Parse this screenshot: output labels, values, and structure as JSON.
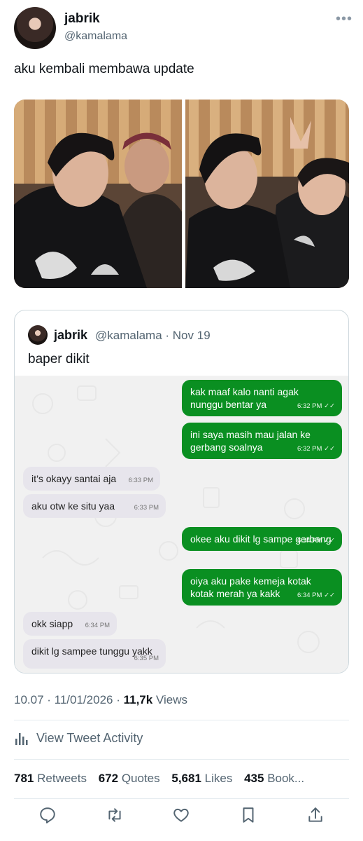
{
  "user": {
    "name": "jabrik",
    "handle": "@kamalama",
    "more_icon": "more-icon"
  },
  "tweet": {
    "text": "aku kembali membawa update"
  },
  "quote": {
    "name": "jabrik",
    "meta": "@kamalama · Nov 19",
    "text": "baper dikit",
    "messages": [
      {
        "dir": "out",
        "text": "kak maaf kalo nanti agak nunggu bentar ya",
        "time": "6:32 PM"
      },
      {
        "dir": "out",
        "text": "ini saya masih mau jalan ke gerbang soalnya",
        "time": "6:32 PM"
      },
      {
        "dir": "in",
        "text": "it’s okayy santai aja",
        "time": "6:33 PM"
      },
      {
        "dir": "in",
        "text": "aku otw ke situ yaa",
        "time": "6:33 PM"
      },
      {
        "dir": "out",
        "text": "okee aku dikit lg sampe gerbang",
        "time": "6:34 PM"
      },
      {
        "dir": "out",
        "text": "oiya aku pake kemeja kotak kotak merah ya kakk",
        "time": "6:34 PM"
      },
      {
        "dir": "in",
        "text": "okk siapp",
        "time": "6:34 PM"
      },
      {
        "dir": "in",
        "text": "dikit lg sampee tunggu yakk",
        "time": "6:35 PM"
      }
    ],
    "read_mark": "✓✓"
  },
  "meta": {
    "time": "10.07",
    "date": "11/01/2026",
    "views_count": "11,7k",
    "views_label": "Views"
  },
  "activity": {
    "label": "View Tweet Activity"
  },
  "stats": {
    "retweets_count": "781",
    "retweets_label": "Retweets",
    "quotes_count": "672",
    "quotes_label": "Quotes",
    "likes_count": "5,681",
    "likes_label": "Likes",
    "bookmarks_count": "435",
    "bookmarks_label": "Book..."
  },
  "colors": {
    "outgoing": "#0a8f21",
    "incoming": "#e7e5ec",
    "muted": "#536471"
  }
}
